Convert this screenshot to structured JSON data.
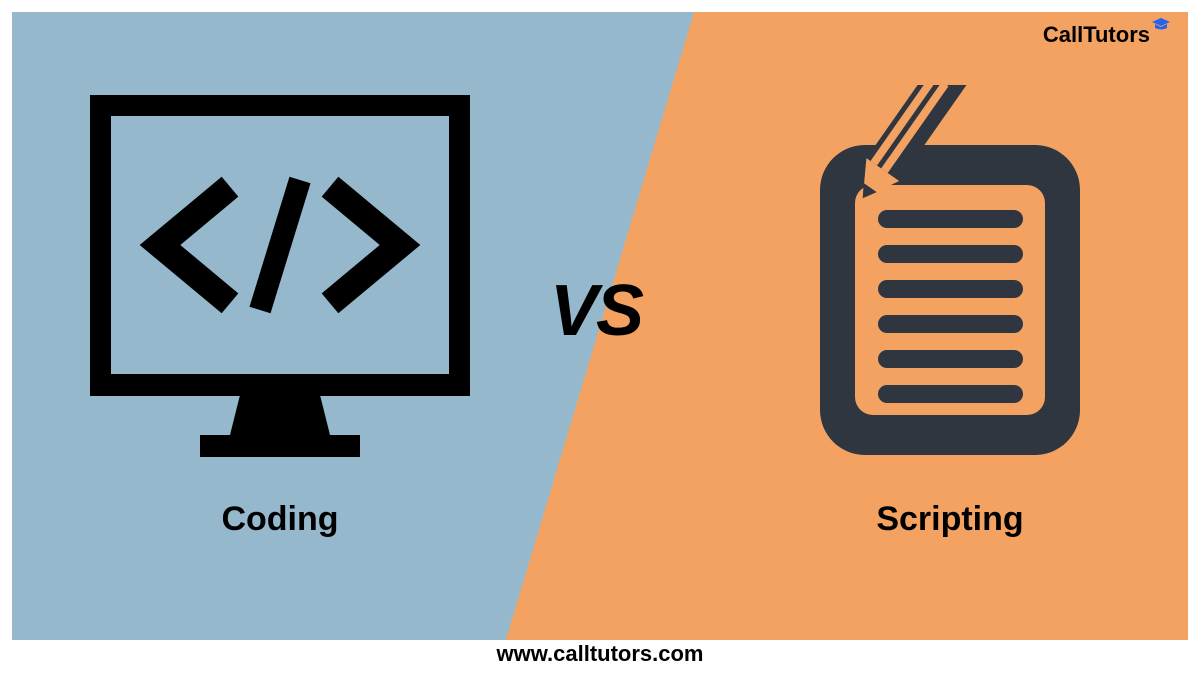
{
  "brand": {
    "name": "CallTutors",
    "icon_name": "graduation-cap-icon"
  },
  "left": {
    "label": "Coding",
    "icon_name": "code-monitor-icon"
  },
  "right": {
    "label": "Scripting",
    "icon_name": "notepad-pencil-icon"
  },
  "center": {
    "vs_text": "VS"
  },
  "footer": {
    "url": "www.calltutors.com"
  },
  "colors": {
    "left_bg": "#95b8cc",
    "right_bg": "#f4a261",
    "icon_dark": "#2f3640",
    "black": "#000000"
  }
}
